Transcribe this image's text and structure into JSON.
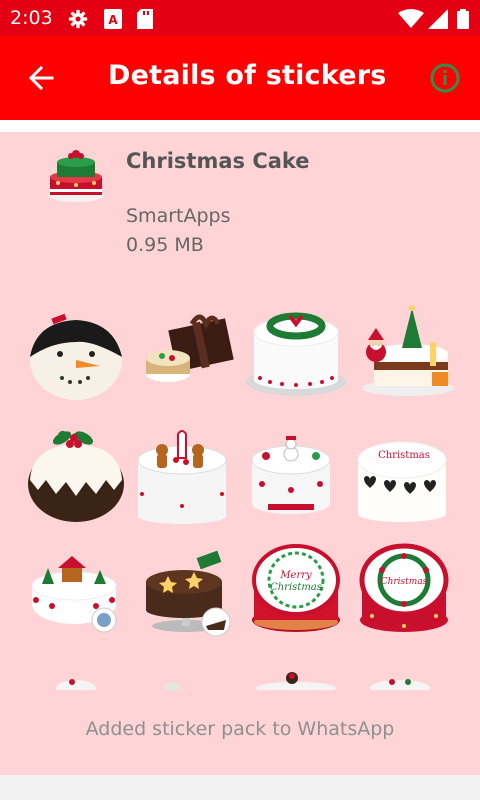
{
  "status_bar": {
    "time": "2:03",
    "left_icons": [
      "settings-icon",
      "accessibility-icon",
      "sd-card-icon"
    ],
    "right_icons": [
      "wifi-icon",
      "signal-icon",
      "battery-icon"
    ]
  },
  "app_bar": {
    "title": "Details of stickers",
    "back_icon": "arrow-left-icon",
    "info_icon": "info-icon",
    "background": "#ff0000"
  },
  "pack": {
    "name": "Christmas Cake",
    "publisher": "SmartApps",
    "size": "0.95 MB"
  },
  "stickers": [
    "snowman cake",
    "gift box and pie",
    "wreath cake",
    "santa tree cake",
    "christmas pudding",
    "gingerbread cake",
    "snowman white cake",
    "hearts cake",
    "christmas village cake",
    "star cake with slice",
    "merry christmas cake",
    "wreath merry christmas cake"
  ],
  "notice": "Added sticker pack to WhatsApp",
  "colors": {
    "status_bar": "#e40012",
    "content_bg": "#ffd4d6",
    "info_icon": "#2f8f4d"
  }
}
